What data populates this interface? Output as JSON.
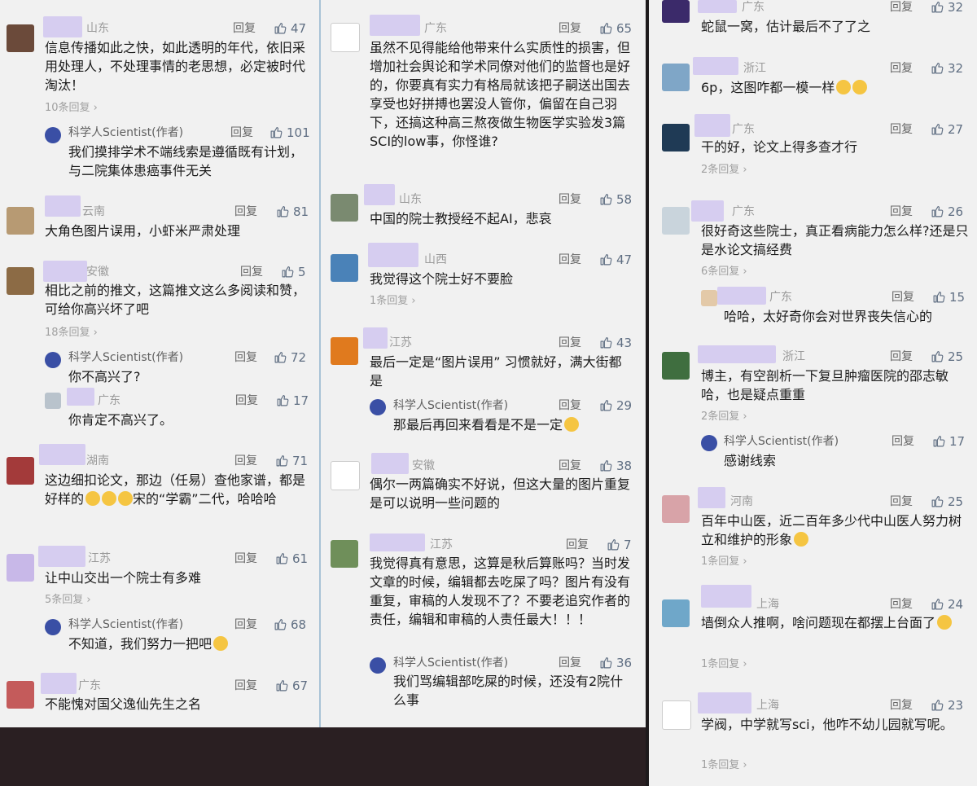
{
  "labels": {
    "reply": "回复",
    "author_name": "科学人Scientist(作者)"
  },
  "col1": {
    "c1": {
      "loc": "山东",
      "likes": "47",
      "text": "信息传播如此之快，如此透明的年代，依旧采用处理人，不处理事情的老思想，必定被时代淘汰！",
      "more": "10条回复 ›",
      "r1": {
        "likes": "101",
        "text": "我们摸排学术不端线索是遵循既有计划，与二院集体患癌事件无关"
      }
    },
    "c2": {
      "loc": "云南",
      "likes": "81",
      "text": "大角色图片误用，小虾米严肃处理"
    },
    "c3": {
      "loc": "安徽",
      "likes": "5",
      "text": "相比之前的推文，这篇推文这么多阅读和赞，可给你高兴坏了吧",
      "more": "18条回复 ›",
      "r1": {
        "likes": "72",
        "text": "你不高兴了?"
      },
      "r2": {
        "loc": "广东",
        "likes": "17",
        "text": "你肯定不高兴了。"
      }
    },
    "c4": {
      "loc": "湖南",
      "likes": "71",
      "text_a": "这边细扣论文，那边（任易）查他家谱，都是好样的",
      "text_b": "宋的“学霸”二代，哈哈哈"
    },
    "c5": {
      "loc": "江苏",
      "likes": "61",
      "text": "让中山交出一个院士有多难",
      "more": "5条回复 ›",
      "r1": {
        "likes": "68",
        "text": "不知道，我们努力一把吧"
      }
    },
    "c6": {
      "loc": "广东",
      "likes": "67",
      "text": "不能愧对国父逸仙先生之名"
    }
  },
  "col2": {
    "c1": {
      "loc": "广东",
      "likes": "65",
      "text": "虽然不见得能给他带来什么实质性的损害，但增加社会舆论和学术同僚对他们的监督也是好的，你要真有实力有格局就该把子嗣送出国去享受也好拼搏也罢没人管你，偏留在自己羽下，还搞这种高三熬夜做生物医学实验发3篇SCI的low事，你怪谁?"
    },
    "c2": {
      "loc": "山东",
      "likes": "58",
      "text": "中国的院士教授经不起AI，悲哀"
    },
    "c3": {
      "loc": "山西",
      "likes": "47",
      "text": "我觉得这个院士好不要脸",
      "more": "1条回复 ›"
    },
    "c4": {
      "loc": "江苏",
      "likes": "43",
      "text": "最后一定是“图片误用” 习惯就好，满大街都是",
      "r1": {
        "likes": "29",
        "text": "那最后再回来看看是不是一定"
      }
    },
    "c5": {
      "loc": "安徽",
      "likes": "38",
      "text": "偶尔一两篇确实不好说，但这大量的图片重复是可以说明一些问题的"
    },
    "c6": {
      "loc": "江苏",
      "likes": "7",
      "text": "我觉得真有意思，这算是秋后算账吗？当时发文章的时候，编辑都去吃屎了吗？图片有没有重复，审稿的人发现不了？不要老追究作者的责任，编辑和审稿的人责任最大！！！",
      "r1": {
        "likes": "36",
        "text": "我们骂编辑部吃屎的时候，还没有2院什么事"
      }
    }
  },
  "col3": {
    "c1": {
      "loc": "广东",
      "likes": "32",
      "text": "蛇鼠一窝，估计最后不了了之"
    },
    "c2": {
      "loc": "浙江",
      "likes": "32",
      "text": "6p，这图咋都一模一样"
    },
    "c3": {
      "loc": "广东",
      "likes": "27",
      "text": "干的好，论文上得多查才行",
      "more": "2条回复 ›"
    },
    "c4": {
      "loc": "广东",
      "likes": "26",
      "text": "很好奇这些院士，真正看病能力怎么样?还是只是水论文搞经费",
      "more": "6条回复 ›",
      "r1": {
        "loc": "广东",
        "likes": "15",
        "text": "哈哈，太好奇你会对世界丧失信心的"
      }
    },
    "c5": {
      "loc": "浙江",
      "likes": "25",
      "text": "博主，有空剖析一下复旦肿瘤医院的邵志敏哈，也是疑点重重",
      "more": "2条回复 ›",
      "r1": {
        "likes": "17",
        "text": "感谢线索"
      }
    },
    "c6": {
      "loc": "河南",
      "likes": "25",
      "text": "百年中山医，近二百年多少代中山医人努力树立和维护的形象",
      "more": "1条回复 ›"
    },
    "c7": {
      "loc": "上海",
      "likes": "24",
      "text": "墙倒众人推啊，啥问题现在都摆上台面了",
      "more": "1条回复 ›"
    },
    "c8": {
      "loc": "上海",
      "likes": "23",
      "text": "学阀，中学就写sci，他咋不幼儿园就写呢。",
      "more": "1条回复 ›"
    }
  }
}
